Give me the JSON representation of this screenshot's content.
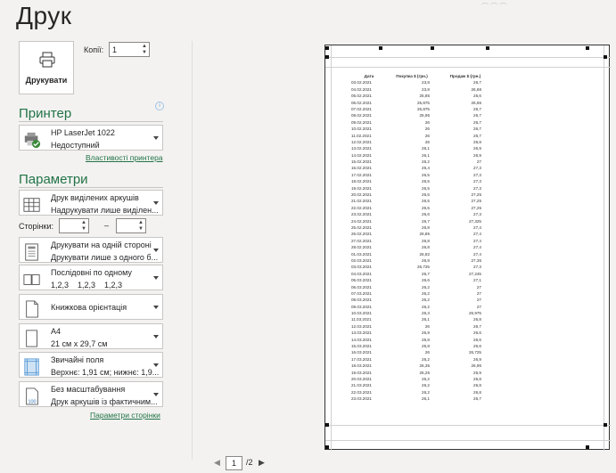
{
  "title": "Друк",
  "print_button": {
    "label": "Друкувати"
  },
  "copies": {
    "label": "Копії:",
    "value": "1"
  },
  "printer_section": {
    "heading": "Принтер",
    "name": "HP LaserJet 1022",
    "status": "Недоступний",
    "properties_link": "Властивості принтера",
    "info_icon": "i"
  },
  "settings_section": {
    "heading": "Параметри",
    "what_to_print": {
      "line1": "Друк виділених аркушів",
      "line2": "Надрукувати лише виділен..."
    },
    "pages": {
      "label": "Сторінки:",
      "from": "",
      "to": "",
      "dash": "–"
    },
    "sides": {
      "line1": "Друкувати на одній стороні",
      "line2": "Друкувати лише з одного б..."
    },
    "collate": {
      "line1": "Послідовні по одному",
      "line2": "1,2,3    1,2,3    1,2,3"
    },
    "orientation": {
      "line1": "Книжкова орієнтація"
    },
    "paper": {
      "line1": "A4",
      "line2": "21 см x 29,7 см"
    },
    "margins": {
      "line1": "Звичайні поля",
      "line2": "Верхнє: 1,91 см; нижнє: 1,9..."
    },
    "scaling": {
      "line1": "Без масштабування",
      "line2": "Друк аркушів із фактичним..."
    },
    "page_setup_link": "Параметри сторінки"
  },
  "navigation": {
    "current_page": "1",
    "total": "/2",
    "prev": "◀",
    "next": "▶"
  },
  "preview_table": {
    "headers": [
      "Дата",
      "Покупка $ (грн.)",
      "Продаж $ (грн.)"
    ],
    "rows": [
      [
        "03.02.2021",
        "23,8",
        "26,7"
      ],
      [
        "04.02.2021",
        "23,8",
        "26,68"
      ],
      [
        "05.02.2021",
        "25,85",
        "26,6"
      ],
      [
        "06.02.2021",
        "25,875",
        "26,65"
      ],
      [
        "07.02.2021",
        "25,875",
        "26,7"
      ],
      [
        "08.02.2021",
        "25,95",
        "26,7"
      ],
      [
        "09.02.2021",
        "26",
        "26,7"
      ],
      [
        "10.02.2021",
        "26",
        "26,7"
      ],
      [
        "11.02.2021",
        "26",
        "26,7"
      ],
      [
        "12.02.2021",
        "26",
        "26,8"
      ],
      [
        "13.02.2021",
        "26,1",
        "26,9"
      ],
      [
        "14.02.2021",
        "26,1",
        "26,9"
      ],
      [
        "15.02.2021",
        "26,2",
        "27"
      ],
      [
        "16.02.2021",
        "26,4",
        "27,3"
      ],
      [
        "17.02.2021",
        "26,5",
        "27,3"
      ],
      [
        "18.02.2021",
        "26,5",
        "27,3"
      ],
      [
        "19.02.2021",
        "26,5",
        "27,3"
      ],
      [
        "20.02.2021",
        "26,5",
        "27,25"
      ],
      [
        "21.02.2021",
        "26,5",
        "27,25"
      ],
      [
        "22.02.2021",
        "26,5",
        "27,25"
      ],
      [
        "23.02.2021",
        "26,6",
        "27,3"
      ],
      [
        "24.02.2021",
        "26,7",
        "27,325"
      ],
      [
        "25.02.2021",
        "26,8",
        "27,4"
      ],
      [
        "26.02.2021",
        "26,85",
        "27,4"
      ],
      [
        "27.02.2021",
        "26,8",
        "27,4"
      ],
      [
        "28.02.2021",
        "26,8",
        "27,4"
      ],
      [
        "01.03.2021",
        "26,82",
        "27,4"
      ],
      [
        "02.03.2021",
        "26,8",
        "27,35"
      ],
      [
        "03.03.2021",
        "26,725",
        "27,3"
      ],
      [
        "04.03.2021",
        "26,7",
        "27,245"
      ],
      [
        "05.03.2021",
        "26,6",
        "27,1"
      ],
      [
        "06.03.2021",
        "26,2",
        "27"
      ],
      [
        "07.03.2021",
        "26,2",
        "27"
      ],
      [
        "08.03.2021",
        "26,2",
        "27"
      ],
      [
        "09.03.2021",
        "26,2",
        "27"
      ],
      [
        "10.03.2021",
        "26,3",
        "26,975"
      ],
      [
        "11.03.2021",
        "26,1",
        "26,8"
      ],
      [
        "12.03.2021",
        "26",
        "26,7"
      ],
      [
        "13.03.2021",
        "25,9",
        "26,6"
      ],
      [
        "14.03.2021",
        "25,8",
        "26,6"
      ],
      [
        "15.03.2021",
        "25,8",
        "26,6"
      ],
      [
        "16.03.2021",
        "26",
        "26,725"
      ],
      [
        "17.03.2021",
        "26,2",
        "26,9"
      ],
      [
        "18.03.2021",
        "26,35",
        "26,95"
      ],
      [
        "19.03.2021",
        "26,25",
        "26,9"
      ],
      [
        "20.03.2021",
        "26,2",
        "26,8"
      ],
      [
        "21.03.2021",
        "26,2",
        "26,8"
      ],
      [
        "22.03.2021",
        "26,2",
        "26,8"
      ],
      [
        "23.03.2021",
        "26,1",
        "26,7"
      ]
    ]
  }
}
